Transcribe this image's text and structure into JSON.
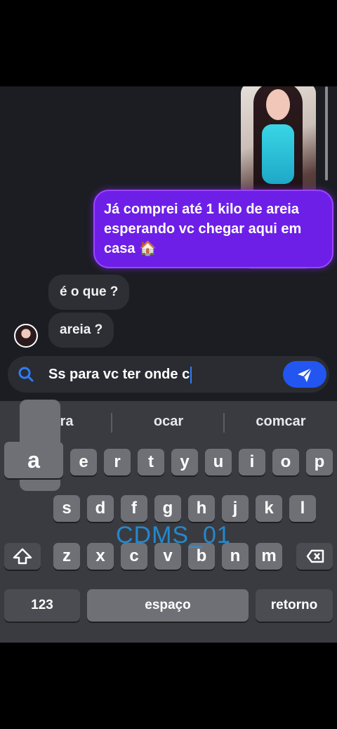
{
  "chat": {
    "messages": [
      {
        "side": "outgoing",
        "text": "Já comprei até 1 kilo de areia esperando vc chegar aqui em casa 🏠"
      },
      {
        "side": "incoming",
        "text": "é o que ?"
      },
      {
        "side": "incoming",
        "text": "areia ?"
      }
    ]
  },
  "composer": {
    "value": "Ss para vc ter onde c"
  },
  "keyboard": {
    "suggestions": [
      "mora",
      "ocar",
      "comcar"
    ],
    "row1": [
      "a",
      "e",
      "r",
      "t",
      "y",
      "u",
      "i",
      "o",
      "p"
    ],
    "row2": [
      "s",
      "d",
      "f",
      "g",
      "h",
      "j",
      "k",
      "l"
    ],
    "row3": [
      "z",
      "x",
      "c",
      "v",
      "b",
      "n",
      "m"
    ],
    "numbers_label": "123",
    "space_label": "espaço",
    "return_label": "retorno",
    "shift_icon": "shift-icon",
    "delete_icon": "backspace-icon"
  },
  "watermark": "CDMS_01",
  "colors": {
    "accent": "#6d1fe8",
    "send": "#2356f0",
    "search": "#2d7dff"
  }
}
